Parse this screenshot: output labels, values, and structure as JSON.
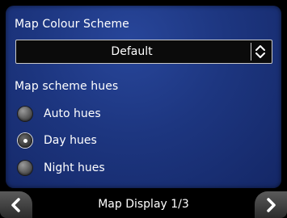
{
  "settings": {
    "map_colour_scheme_label": "Map Colour Scheme",
    "map_colour_scheme_value": "Default",
    "map_scheme_hues_label": "Map scheme hues",
    "hue_options": [
      {
        "label": "Auto hues",
        "selected": false
      },
      {
        "label": "Day hues",
        "selected": true
      },
      {
        "label": "Night hues",
        "selected": false
      }
    ]
  },
  "footer": {
    "title": "Map Display 1/3"
  },
  "icons": {
    "dropdown": "chevron-up-down-icon",
    "prev": "chevron-left-icon",
    "next": "chevron-right-icon"
  },
  "colors": {
    "panel_blue": "#1d3680",
    "accent_white": "#ffffff"
  }
}
